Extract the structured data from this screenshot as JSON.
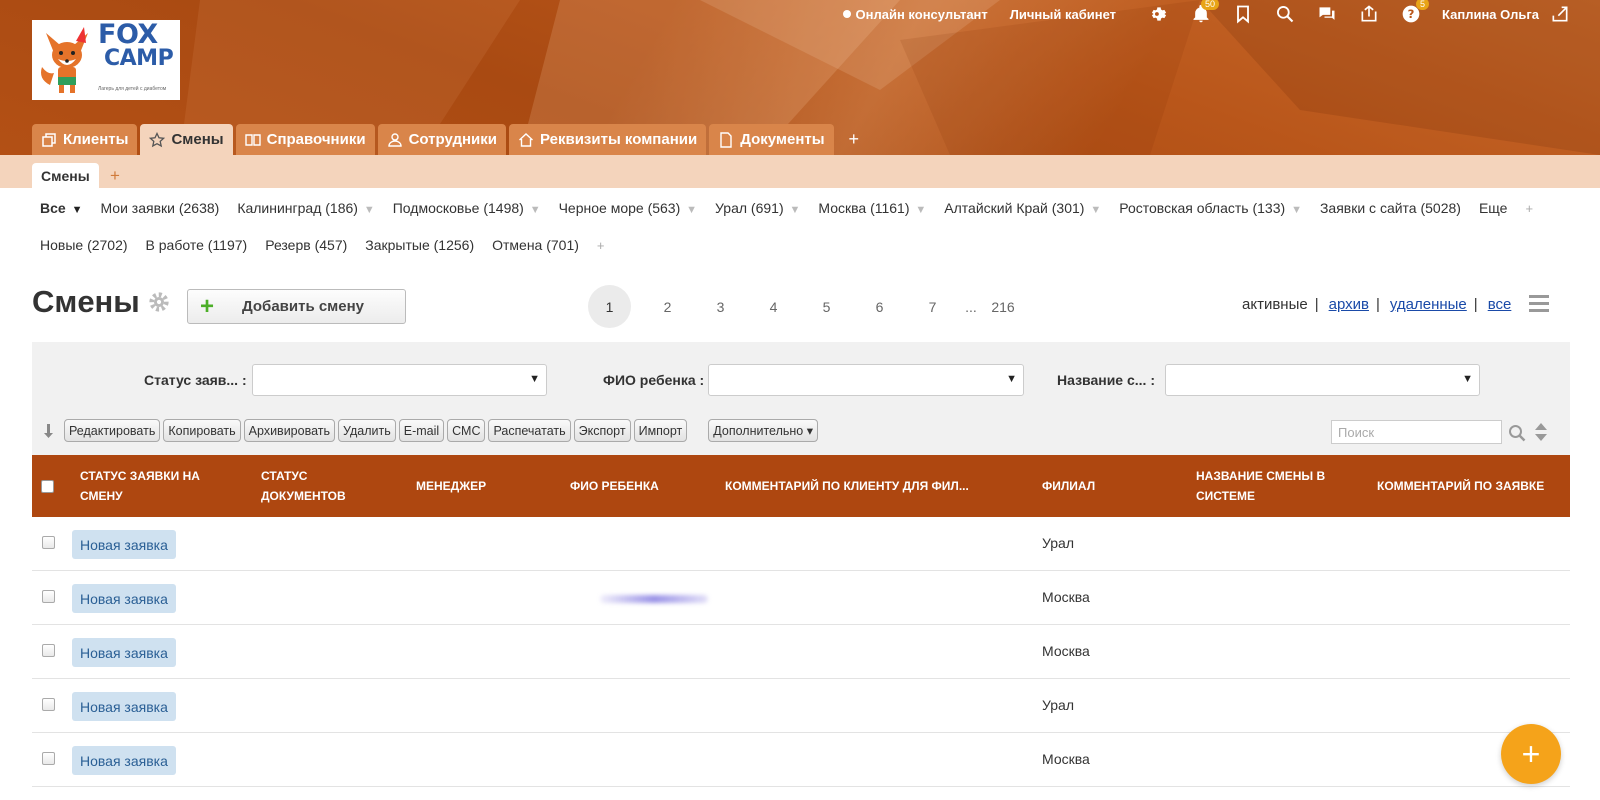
{
  "brand": {
    "logo_line1": "FOX",
    "logo_line2": "CAMP",
    "logo_tagline": "Лагерь для детей с диабетом"
  },
  "topbar": {
    "consultant": "Онлайн консультант",
    "cabinet": "Личный кабинет",
    "notifications_badge": "50",
    "help_badge": "5",
    "user": "Каплина Ольга"
  },
  "tabs": [
    {
      "label": "Клиенты",
      "icon": "copy-icon"
    },
    {
      "label": "Смены",
      "icon": "star-icon",
      "active": true
    },
    {
      "label": "Справочники",
      "icon": "book-icon"
    },
    {
      "label": "Сотрудники",
      "icon": "people-icon"
    },
    {
      "label": "Реквизиты компании",
      "icon": "home-icon"
    },
    {
      "label": "Документы",
      "icon": "document-icon"
    }
  ],
  "tabs_add": "+",
  "subtab": {
    "label": "Смены",
    "add": "+"
  },
  "filters_row1": [
    {
      "label": "Все",
      "arrow": "▼"
    },
    {
      "label": "Мои заявки (2638)"
    },
    {
      "label": "Калининград (186)",
      "arrow": "▼"
    },
    {
      "label": "Подмосковье (1498)",
      "arrow": "▼"
    },
    {
      "label": "Черное море (563)",
      "arrow": "▼"
    },
    {
      "label": "Урал (691)",
      "arrow": "▼"
    },
    {
      "label": "Москва (1161)",
      "arrow": "▼"
    },
    {
      "label": "Алтайский Край (301)",
      "arrow": "▼"
    },
    {
      "label": "Ростовская область (133)",
      "arrow": "▼"
    },
    {
      "label": "Заявки с сайта (5028)"
    },
    {
      "label": "Еще"
    }
  ],
  "filters_row2": [
    {
      "label": "Новые (2702)"
    },
    {
      "label": "В работе (1197)"
    },
    {
      "label": "Резерв (457)"
    },
    {
      "label": "Закрытые (1256)"
    },
    {
      "label": "Отмена (701)"
    }
  ],
  "filters_add": "+",
  "page": {
    "title": "Смены",
    "add_button": "Добавить смену",
    "add_plus": "+",
    "pages": [
      "1",
      "2",
      "3",
      "4",
      "5",
      "6",
      "7",
      "...",
      "216"
    ],
    "current_page": "1",
    "view_active": "активные",
    "view_archive": "архив",
    "view_deleted": "удаленные",
    "view_all": "все",
    "sep": "|"
  },
  "filter_panel": {
    "status_label": "Статус заяв... :",
    "child_label": "ФИО ребенка :",
    "shift_label": "Название с... :",
    "caret": "▼"
  },
  "actions": [
    "Редактировать",
    "Копировать",
    "Архивировать",
    "Удалить",
    "E-mail",
    "СМС",
    "Распечатать",
    "Экспорт",
    "Импорт"
  ],
  "more_button": "Дополнительно ▾",
  "search_placeholder": "Поиск",
  "columns": [
    "СТАТУС ЗАЯВКИ НА СМЕНУ",
    "СТАТУС ДОКУМЕНТОВ",
    "МЕНЕДЖЕР",
    "ФИО РЕБЕНКА",
    "КОММЕНТАРИЙ ПО КЛИЕНТУ ДЛЯ ФИЛ...",
    "ФИЛИАЛ",
    "НАЗВАНИЕ СМЕНЫ В СИСТЕМЕ",
    "КОММЕНТАРИЙ ПО ЗАЯВКЕ"
  ],
  "rows": [
    {
      "status": "Новая заявка",
      "branch": "Урал"
    },
    {
      "status": "Новая заявка",
      "branch": "Москва"
    },
    {
      "status": "Новая заявка",
      "branch": "Москва"
    },
    {
      "status": "Новая заявка",
      "branch": "Урал"
    },
    {
      "status": "Новая заявка",
      "branch": "Москва"
    }
  ],
  "fab": "+",
  "colors": {
    "header": "#b9561a",
    "table_header": "#ae4710",
    "accent": "#f5a31a",
    "status_chip": "#cfe1f0",
    "subbar": "#f4d4bc"
  }
}
